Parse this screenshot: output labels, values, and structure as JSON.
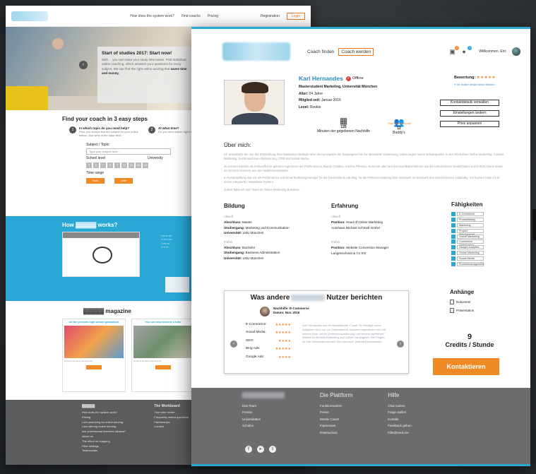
{
  "back": {
    "nav": [
      "How does the system work?",
      "Find coachs",
      "Pricing"
    ],
    "registration": "Registration",
    "login": "Login",
    "hero_title": "Start of studies 2017: Start now!",
    "hero_text": "With ... you can make your study time easier. Find individual online coaching, which answers your questions for every subject. We can find the right online tutoring that",
    "hero_bold": "saves time and money.",
    "steps_title": "Find your coach in 3 easy steps",
    "step1_title": "In which topic do you need help?",
    "step1_text": "First, you should find the subject for your online tuition. Just write in the input field.",
    "step2_title": "At what time?",
    "step2_text": "Do you need tuition right now or at a later date?",
    "subject_label": "Subject / Topic:",
    "subject_placeholder": "Type your subject here...",
    "school_level": "School level",
    "university": "University",
    "time_range": "Time range",
    "btn_now": "Now",
    "btn_later": "Later",
    "how_works": "How",
    "how_works2": "works?",
    "magazine": "magazine",
    "card1_title": "All the persons high school graduation",
    "card2_title": "You can now become a tutor",
    "footer_col1": [
      "How does the system work?",
      "Pricing",
      "I am searching for online tutoring",
      "I am offering online tutoring",
      "Are professional teachers allowed?",
      "About us",
      "The effect on mapping",
      "Filter settings",
      "Testimonials"
    ],
    "footer_col2_title": "The Workboard",
    "footer_col2": [
      "Your tutor center",
      "Frequently asked questions",
      "Partnerships",
      "Contact"
    ]
  },
  "front": {
    "nav_find": "Coach finden",
    "nav_become": "Coach werden",
    "welcome": "Willkommen, Eric",
    "badge1": "2",
    "badge2": "3",
    "name": "Karl Hernandes",
    "status": "Offline",
    "subtitle": "Masterstudent Marketing, Universität München",
    "age_label": "Alter:",
    "age": "24 Jahre",
    "member_label": "Mitglied seit:",
    "member": "Januar 2016",
    "level_label": "Level:",
    "level": "Rookie",
    "stat1_num": "125",
    "stat1_label": "Minuten der gegebenen Nachhilfe",
    "stat2_num": "12",
    "stat2_label": "Buddy's",
    "buddy_link": "Fügen Sie als Buddy!",
    "rating_label": "Bewertung:",
    "rating_stars": "★★★★★",
    "verified": "Ihr Nutzer besitzt seine Session",
    "btn_contact_details": "Kontaktdetails verwalten",
    "btn_settings": "Einstellungen ändern",
    "btn_price": "Preis anpassen",
    "about_title": "Über mich:",
    "about_p1": "Ich unterstütze Sie von der Entwicklung Ihrer Marketing-Strategie über die Konzeption der Kampagnen bis zur operativen Umsetzung. Dabei liegen meine Schwerpunkte in den Disziplinen Online Marketing, Content Marketing, Suchmaschinen-Optimierung, CRM und Social Media.",
    "about_p2": "Zu meinen Kunden als freiberuflicher gehören Agenturen wie Proliteratur.at, Bundy Creative, Kitchen Phoenix, Kommen oder laut Kommunikationsfirmen wie die Unternehmen Deutschland und DAKOU Bonn sowie ein DAKOU Konzern aus der Healthcareindustrie.",
    "about_p3": "In Festanstellung war ich als Performance und Email Marketingmanager für die Deutschland Lab tätig, für die Partnerverwaltung bzw. Netzwerk im Netzwerk des Unternehmens zuständig. Vor kurzem habe ich in einem integrierten Newsletter-System.",
    "about_p4": "Zuletzt habe ich zum Team im Online Marketing Business.",
    "edu_title": "Bildung",
    "edu_now": "Aktuell",
    "edu1_deg_label": "Abschluss:",
    "edu1_deg": "Master",
    "edu1_field_label": "Studiengang:",
    "edu1_field": "Marketing und Kommunikation",
    "edu1_uni_label": "Universität:",
    "edu1_uni": "LMU München",
    "edu_prev": "Früher",
    "edu2_deg": "Bachelor",
    "edu2_field": "Business Administration",
    "edu2_uni": "LMU München",
    "exp_title": "Erfahrung",
    "exp_now": "Aktuell",
    "exp1_pos_label": "Position:",
    "exp1_pos": "Head of Online Marketing",
    "exp1_company": "Autohaus Michael Schmidt GmbH",
    "exp_prev": "Früher",
    "exp2_pos": "Website Conversion Manager",
    "exp2_company": "Langenscheidt & Co KG",
    "skills_title": "Fähigkeiten",
    "skills": [
      "E-Commerce",
      "Produktlisting",
      "Marketing",
      "Project Management",
      "Online Marketing",
      "Conversion Optimization",
      "Google Analytics",
      "Online Marketing",
      "Social Media",
      "Produktmanagement"
    ],
    "review_title_a": "Was andere",
    "review_title_b": "Nutzer berichten",
    "reviewer_sub": "Nachhilfe: E-Commerce",
    "reviewer_date": "Datum: Nov. 2016",
    "rate_labels": [
      "E-Commerce:",
      "Social Media:",
      "SEO:",
      "Bing Ads:",
      "Google Ads:"
    ],
    "rate_stars": [
      "★★★★★",
      "★★★★★",
      "★★★★",
      "★★★★★",
      "★★★★"
    ],
    "review_text": "Karl Hernandes war ein fantastischer Coach. Er erledigte seine Aufgaben nicht nur zur Zufriedenheit, sondern begeisterte mich mit seinem Elan, seiner perfekten Ausführung und seinem fachlichen Wissen im Bereich Marketing und Online Kampagnen. Bei Fragen zu Karl Hernandes können Sie mich auch jederzeit kontaktieren",
    "attach_title": "Anhänge",
    "attach1": "Dokument",
    "attach2": "Präsentation",
    "credits_num": "9",
    "credits_label": "Credits / Stunde",
    "contact_btn": "Kontaktieren",
    "footer_col1": [
      "Das Team",
      "Presse",
      "Universitäten",
      "Schulen"
    ],
    "footer_col2_title": "Die Plattform",
    "footer_col2": [
      "Funktionsweise",
      "Preise",
      "Werde Coach",
      "Impressum",
      "Datenschutz"
    ],
    "footer_col3_title": "Hilfe",
    "footer_col3": [
      "Chat nutzen",
      "Frage stellen",
      "Kontakt",
      "Feedback geben",
      "hilfe@nerd.me"
    ]
  }
}
